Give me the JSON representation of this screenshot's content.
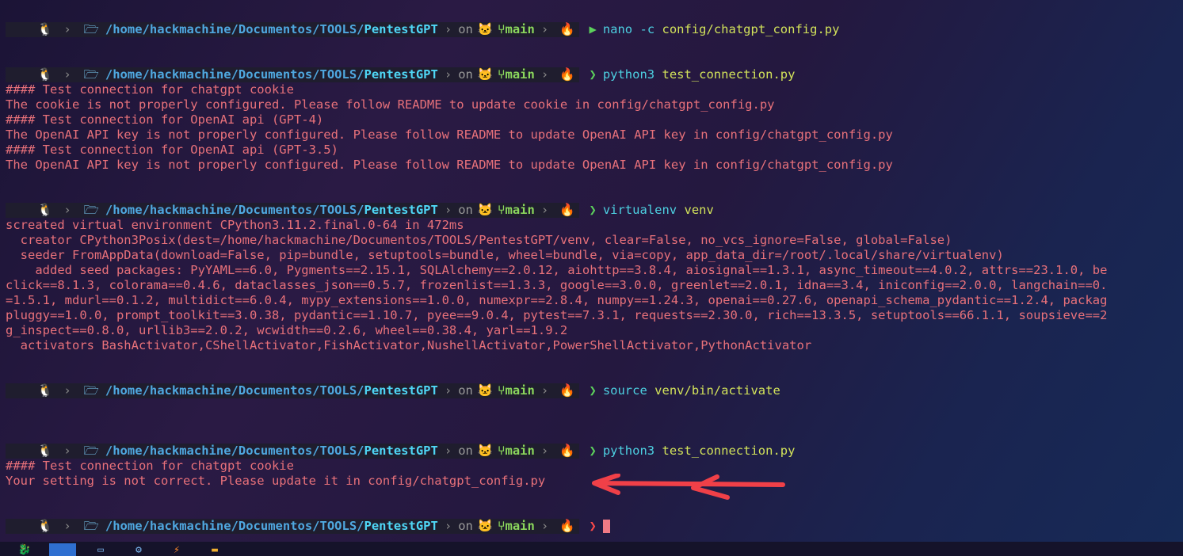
{
  "prompt": {
    "path_prefix": "/home/hackmachine/Documentos/TOOLS/",
    "path_last": "PentestGPT",
    "on": "on",
    "branch": "main"
  },
  "blocks": {
    "cmd1": {
      "cmd": "nano",
      "args": "-c",
      "file": "config/chatgpt_config.py"
    },
    "cmd2": {
      "cmd": "python3",
      "file": "test_connection.py"
    },
    "out2": [
      "#### Test connection for chatgpt cookie",
      "The cookie is not properly configured. Please follow README to update cookie in config/chatgpt_config.py",
      "#### Test connection for OpenAI api (GPT-4)",
      "The OpenAI API key is not properly configured. Please follow README to update OpenAI API key in config/chatgpt_config.py",
      "#### Test connection for OpenAI api (GPT-3.5)",
      "The OpenAI API key is not properly configured. Please follow README to update OpenAI API key in config/chatgpt_config.py"
    ],
    "cmd3": {
      "cmd": "virtualenv",
      "file": "venv"
    },
    "out3": [
      "screated virtual environment CPython3.11.2.final.0-64 in 472ms",
      "  creator CPython3Posix(dest=/home/hackmachine/Documentos/TOOLS/PentestGPT/venv, clear=False, no_vcs_ignore=False, global=False)",
      "  seeder FromAppData(download=False, pip=bundle, setuptools=bundle, wheel=bundle, via=copy, app_data_dir=/root/.local/share/virtualenv)",
      "    added seed packages: PyYAML==6.0, Pygments==2.15.1, SQLAlchemy==2.0.12, aiohttp==3.8.4, aiosignal==1.3.1, async_timeout==4.0.2, attrs==23.1.0, be",
      "click==8.1.3, colorama==0.4.6, dataclasses_json==0.5.7, frozenlist==1.3.3, google==3.0.0, greenlet==2.0.1, idna==3.4, iniconfig==2.0.0, langchain==0.",
      "=1.5.1, mdurl==0.1.2, multidict==6.0.4, mypy_extensions==1.0.0, numexpr==2.8.4, numpy==1.24.3, openai==0.27.6, openapi_schema_pydantic==1.2.4, packag",
      "pluggy==1.0.0, prompt_toolkit==3.0.38, pydantic==1.10.7, pyee==9.0.4, pytest==7.3.1, requests==2.30.0, rich==13.3.5, setuptools==66.1.1, soupsieve==2",
      "g_inspect==0.8.0, urllib3==2.0.2, wcwidth==0.2.6, wheel==0.38.4, yarl==1.9.2",
      "  activators BashActivator,CShellActivator,FishActivator,NushellActivator,PowerShellActivator,PythonActivator"
    ],
    "cmd4": {
      "cmd": "source",
      "file": "venv/bin/activate"
    },
    "cmd5": {
      "cmd": "python3",
      "file": "test_connection.py"
    },
    "out5": [
      "#### Test connection for chatgpt cookie",
      "Your setting is not correct. Please update it in config/chatgpt_config.py"
    ]
  },
  "icons": {
    "os": "tux-icon",
    "folder": "folder-icon",
    "git": "github-cat-icon",
    "branch": "git-branch-icon",
    "status": "flame-icon",
    "prompt_ok": "chevron-right-icon",
    "prompt_err": "chevron-right-icon"
  },
  "colors": {
    "output": "#e8717a",
    "command": "#4dd0e1",
    "argument": "#d2e25a",
    "ok_arrow": "#5cd15c",
    "error_arrow": "#ff4a4a",
    "annotation_arrow": "#f04048"
  }
}
